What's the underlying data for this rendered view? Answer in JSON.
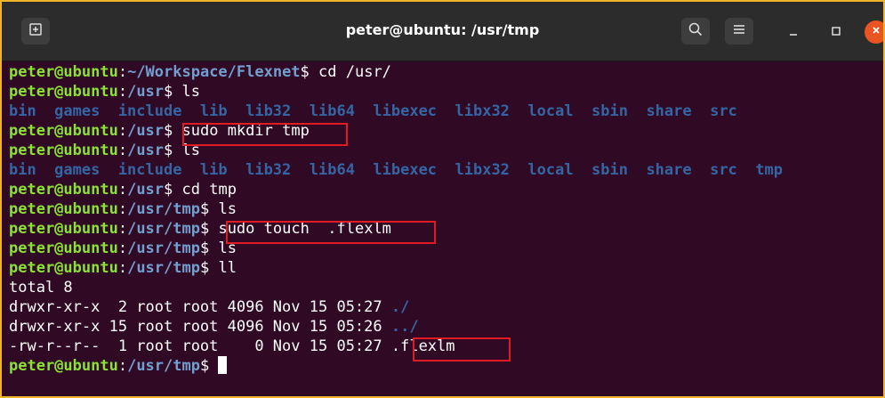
{
  "window": {
    "title": "peter@ubuntu: /usr/tmp",
    "icons": {
      "new_tab": "new-tab-icon",
      "search": "search-icon",
      "menu": "hamburger-menu-icon",
      "minimize": "minimize-icon",
      "maximize": "maximize-icon",
      "close": "close-icon"
    },
    "accent_color": "#e95420",
    "background_color": "#300a24"
  },
  "terminal": {
    "lines": [
      {
        "user": "peter@ubuntu",
        "colon": ":",
        "path": "~/Workspace/Flexnet",
        "sep": "$ ",
        "cmd": "cd /usr/"
      },
      {
        "user": "peter@ubuntu",
        "colon": ":",
        "path": "/usr",
        "sep": "$ ",
        "cmd": "ls"
      },
      {
        "dirs": "bin  games  include  lib  lib32  lib64  libexec  libx32  local  sbin  share  src"
      },
      {
        "user": "peter@ubuntu",
        "colon": ":",
        "path": "/usr",
        "sep": "$ ",
        "cmd": "sudo mkdir tmp"
      },
      {
        "user": "peter@ubuntu",
        "colon": ":",
        "path": "/usr",
        "sep": "$ ",
        "cmd": "ls"
      },
      {
        "dirs": "bin  games  include  lib  lib32  lib64  libexec  libx32  local  sbin  share  src  tmp"
      },
      {
        "user": "peter@ubuntu",
        "colon": ":",
        "path": "/usr",
        "sep": "$ ",
        "cmd": "cd tmp"
      },
      {
        "user": "peter@ubuntu",
        "colon": ":",
        "path": "/usr/tmp",
        "sep": "$ ",
        "cmd": "ls"
      },
      {
        "user": "peter@ubuntu",
        "colon": ":",
        "path": "/usr/tmp",
        "sep": "$ ",
        "cmd": "sudo touch  .flexlm"
      },
      {
        "user": "peter@ubuntu",
        "colon": ":",
        "path": "/usr/tmp",
        "sep": "$ ",
        "cmd": "ls"
      },
      {
        "user": "peter@ubuntu",
        "colon": ":",
        "path": "/usr/tmp",
        "sep": "$ ",
        "cmd": "ll"
      },
      {
        "text": "total 8"
      },
      {
        "text": "drwxr-xr-x  2 root root 4096 Nov 15 05:27 ",
        "name": "./"
      },
      {
        "text": "drwxr-xr-x 15 root root 4096 Nov 15 05:26 ",
        "name": "../"
      },
      {
        "text": "-rw-r--r--  1 root root    0 Nov 15 05:27 ",
        "name": ".flexlm"
      },
      {
        "user": "peter@ubuntu",
        "colon": ":",
        "path": "/usr/tmp",
        "sep": "$ ",
        "cmd": ""
      }
    ]
  }
}
